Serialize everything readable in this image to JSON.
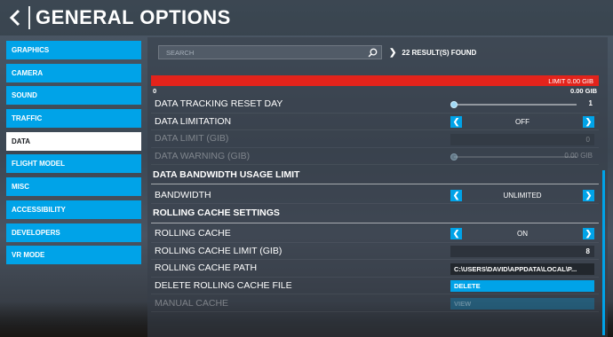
{
  "header": {
    "title": "GENERAL OPTIONS"
  },
  "sidebar": {
    "items": [
      {
        "label": "GRAPHICS",
        "active": false
      },
      {
        "label": "CAMERA",
        "active": false
      },
      {
        "label": "SOUND",
        "active": false
      },
      {
        "label": "TRAFFIC",
        "active": false
      },
      {
        "label": "DATA",
        "active": true
      },
      {
        "label": "FLIGHT MODEL",
        "active": false
      },
      {
        "label": "MISC",
        "active": false
      },
      {
        "label": "ACCESSIBILITY",
        "active": false
      },
      {
        "label": "DEVELOPERS",
        "active": false
      },
      {
        "label": "VR MODE",
        "active": false
      }
    ]
  },
  "search": {
    "placeholder": "SEARCH",
    "value": "",
    "results": "22 RESULT(S) FOUND"
  },
  "usage": {
    "limit_label": "LIMIT 0.00 GIB",
    "min_label": "0",
    "max_label": "0.00 GIB",
    "fill_fraction": 1.0
  },
  "data_rows": {
    "tracking_reset": {
      "label": "DATA TRACKING RESET DAY",
      "value": "1",
      "level": 0.0
    },
    "limitation": {
      "label": "DATA LIMITATION",
      "value": "OFF"
    },
    "data_limit": {
      "label": "DATA LIMIT (GIB)",
      "value": "0"
    },
    "data_warning": {
      "label": "DATA WARNING (GIB)",
      "value": "0.00 GIB",
      "level": 0.0
    }
  },
  "bandwidth_section": {
    "title": "DATA BANDWIDTH USAGE LIMIT",
    "bandwidth": {
      "label": "BANDWIDTH",
      "value": "UNLIMITED"
    }
  },
  "cache_section": {
    "title": "ROLLING CACHE SETTINGS",
    "rolling_cache": {
      "label": "ROLLING CACHE",
      "value": "ON"
    },
    "cache_limit": {
      "label": "ROLLING CACHE LIMIT (GIB)",
      "value": "8"
    },
    "cache_path": {
      "label": "ROLLING CACHE PATH",
      "value": "C:\\USERS\\DAVID\\APPDATA\\LOCAL\\P..."
    },
    "delete_cache": {
      "label": "DELETE ROLLING CACHE FILE",
      "button": "DELETE"
    },
    "manual_cache": {
      "label": "MANUAL CACHE",
      "button": "VIEW"
    }
  },
  "icons": {
    "back": "chevron-left-icon",
    "search": "search-icon",
    "prev": "chevron-left-icon",
    "next": "chevron-right-icon"
  },
  "colors": {
    "accent": "#00a3e8",
    "danger": "#e3231b",
    "active_bg": "#ffffff"
  }
}
